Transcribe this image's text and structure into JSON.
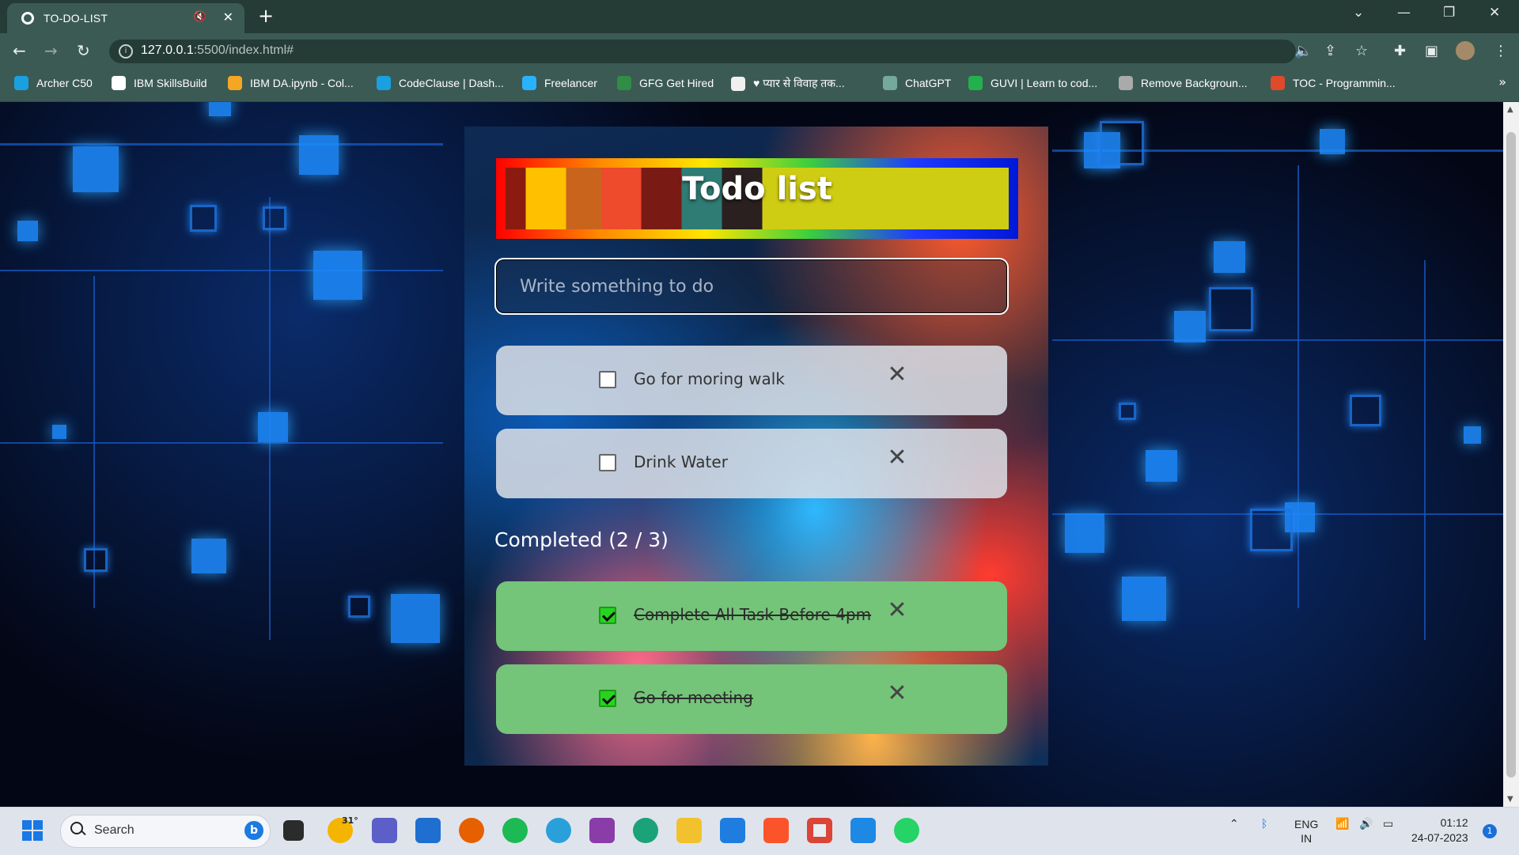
{
  "browser": {
    "tab_title": "TO-DO-LIST",
    "url_host": "127.0.0.1",
    "url_rest": ":5500/index.html#",
    "bookmarks": [
      {
        "label": "Archer C50",
        "color": "#1aa0e0"
      },
      {
        "label": "IBM SkillsBuild",
        "color": "#ffffff"
      },
      {
        "label": "IBM DA.ipynb - Col...",
        "color": "#f5a623"
      },
      {
        "label": "CodeClause | Dash...",
        "color": "#1aa0e0"
      },
      {
        "label": "Freelancer",
        "color": "#29b2fe"
      },
      {
        "label": "GFG Get Hired",
        "color": "#2f8d46"
      },
      {
        "label": "♥ प्यार से विवाह तक...",
        "color": "#f0f0f0"
      },
      {
        "label": "ChatGPT",
        "color": "#74aa9c"
      },
      {
        "label": "GUVI | Learn to cod...",
        "color": "#22b14c"
      },
      {
        "label": "Remove Backgroun...",
        "color": "#aaaaaa"
      },
      {
        "label": "TOC - Programmin...",
        "color": "#e04a2a"
      }
    ]
  },
  "app": {
    "title": "Todo list",
    "input_placeholder": "Write something to do",
    "pending": [
      {
        "text": "Go for moring walk",
        "checked": false
      },
      {
        "text": "Drink Water",
        "checked": false
      }
    ],
    "completed_label": "Completed (2 / 3)",
    "completed": [
      {
        "text": "Complete All Task Before 4pm",
        "checked": true
      },
      {
        "text": "Go for meeting",
        "checked": true
      }
    ],
    "delete_glyph": "✕"
  },
  "taskbar": {
    "search_placeholder": "Search",
    "weather": "31°",
    "lang_line1": "ENG",
    "lang_line2": "IN",
    "time": "01:12",
    "date": "24-07-2023",
    "notification_count": "1"
  }
}
